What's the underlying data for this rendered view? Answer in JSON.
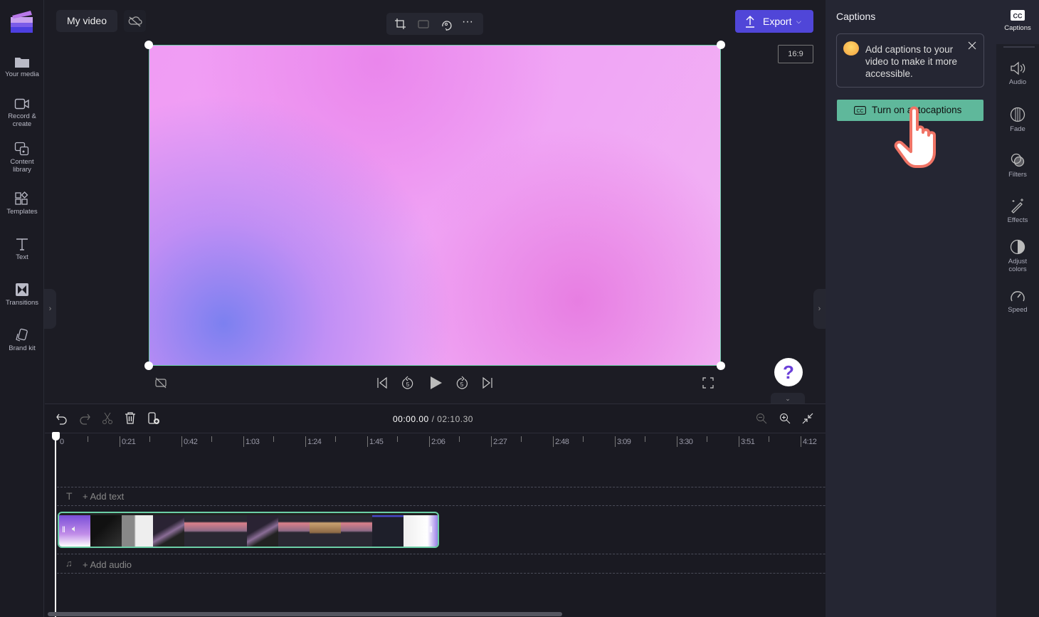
{
  "sidebar": {
    "items": [
      {
        "label": "Your media",
        "icon": "folder-icon"
      },
      {
        "label": "Record &",
        "label2": "create",
        "icon": "camera-icon"
      },
      {
        "label": "Content",
        "label2": "library",
        "icon": "content-library-icon"
      },
      {
        "label": "Templates",
        "icon": "templates-icon"
      },
      {
        "label": "Text",
        "icon": "text-icon"
      },
      {
        "label": "Transitions",
        "icon": "transitions-icon"
      },
      {
        "label": "Brand kit",
        "icon": "brand-kit-icon"
      }
    ]
  },
  "header": {
    "title": "My video",
    "export_label": "Export",
    "aspect_ratio": "16:9"
  },
  "player": {
    "current_time": "00:00.00",
    "total_time": "/ 02:10.30"
  },
  "timeline": {
    "ruler": [
      "0",
      "0:21",
      "0:42",
      "1:03",
      "1:24",
      "1:45",
      "2:06",
      "2:27",
      "2:48",
      "3:09",
      "3:30",
      "3:51",
      "4:12"
    ],
    "add_text": "+ Add text",
    "add_audio": "+ Add audio"
  },
  "captions_panel": {
    "title": "Captions",
    "tip": "Add captions to your video to make it more accessible.",
    "button": "Turn on autocaptions"
  },
  "rail": {
    "items": [
      {
        "label": "Captions"
      },
      {
        "label": "Audio"
      },
      {
        "label": "Fade"
      },
      {
        "label": "Filters"
      },
      {
        "label": "Effects"
      },
      {
        "label": "Adjust",
        "label2": "colors"
      },
      {
        "label": "Speed"
      }
    ]
  },
  "colors": {
    "accent": "#5046d8",
    "selection": "#6ccfa7",
    "caption_button": "#5fb89b"
  }
}
